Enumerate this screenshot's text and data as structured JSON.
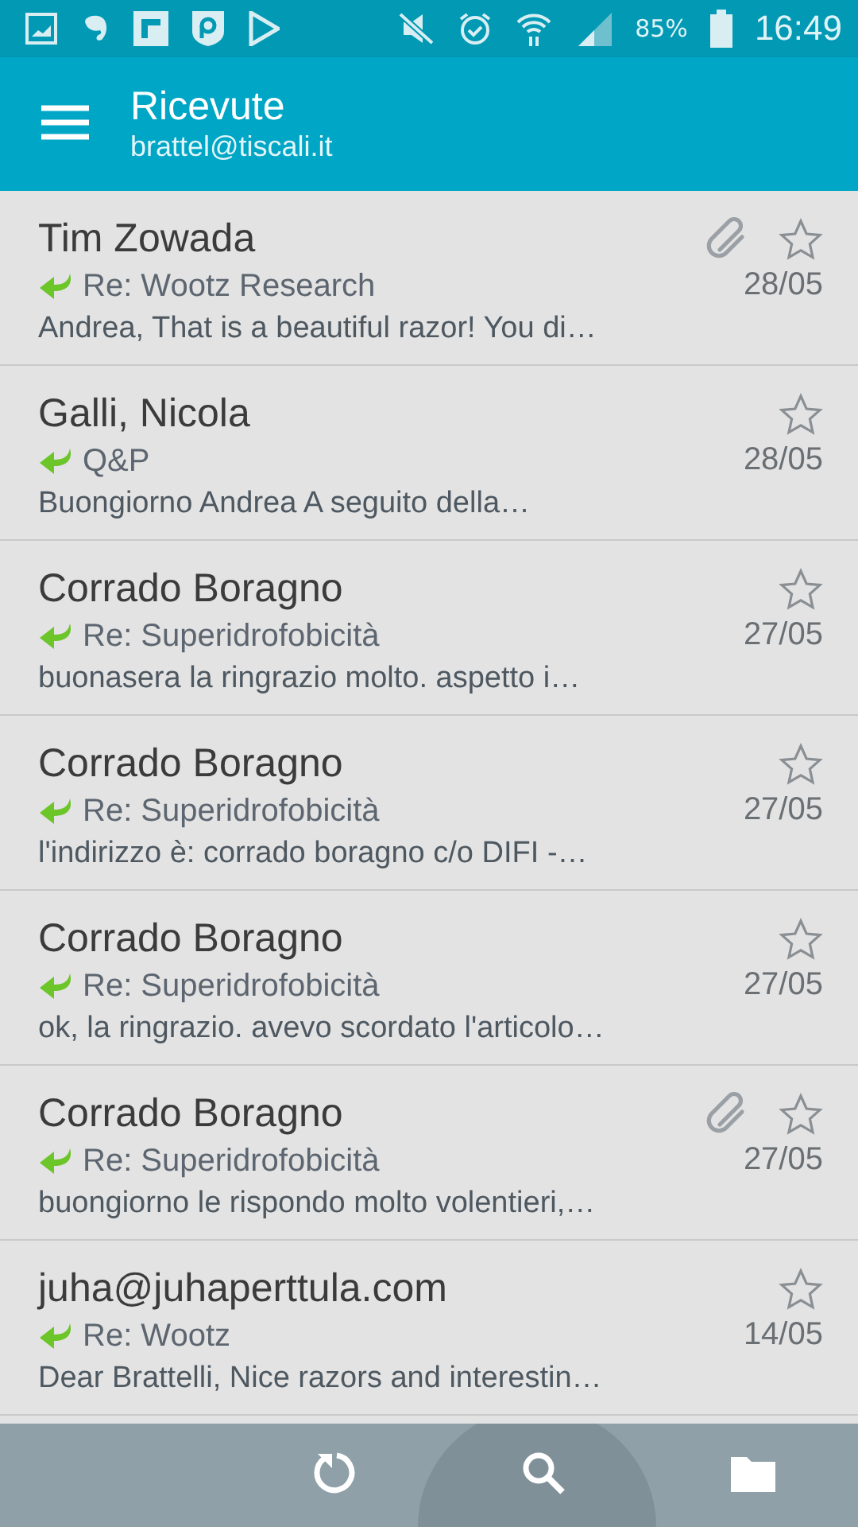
{
  "status_bar": {
    "battery": "85%",
    "time": "16:49"
  },
  "app_bar": {
    "title": "Ricevute",
    "account": "brattel@tiscali.it"
  },
  "messages": [
    {
      "sender": "Tim Zowada",
      "subject": "Re: Wootz Research",
      "preview": "Andrea, That is a beautiful razor! You di…",
      "date": "28/05",
      "attachment": true,
      "starred": false,
      "replied": true
    },
    {
      "sender": "Galli, Nicola",
      "subject": "Q&P",
      "preview": "Buongiorno Andrea A seguito della…",
      "date": "28/05",
      "attachment": false,
      "starred": false,
      "replied": true
    },
    {
      "sender": "Corrado Boragno",
      "subject": "Re: Superidrofobicità",
      "preview": "buonasera la ringrazio molto. aspetto i…",
      "date": "27/05",
      "attachment": false,
      "starred": false,
      "replied": true
    },
    {
      "sender": "Corrado Boragno",
      "subject": "Re: Superidrofobicità",
      "preview": "l'indirizzo è: corrado boragno c/o DIFI -…",
      "date": "27/05",
      "attachment": false,
      "starred": false,
      "replied": true
    },
    {
      "sender": "Corrado Boragno",
      "subject": "Re: Superidrofobicità",
      "preview": "ok, la ringrazio. avevo scordato l'articolo…",
      "date": "27/05",
      "attachment": false,
      "starred": false,
      "replied": true
    },
    {
      "sender": "Corrado Boragno",
      "subject": "Re: Superidrofobicità",
      "preview": "buongiorno le rispondo molto volentieri,…",
      "date": "27/05",
      "attachment": true,
      "starred": false,
      "replied": true
    },
    {
      "sender": "juha@juhaperttula.com",
      "subject": "Re: Wootz",
      "preview": "Dear Brattelli, Nice razors and interestin…",
      "date": "14/05",
      "attachment": false,
      "starred": false,
      "replied": true
    }
  ]
}
